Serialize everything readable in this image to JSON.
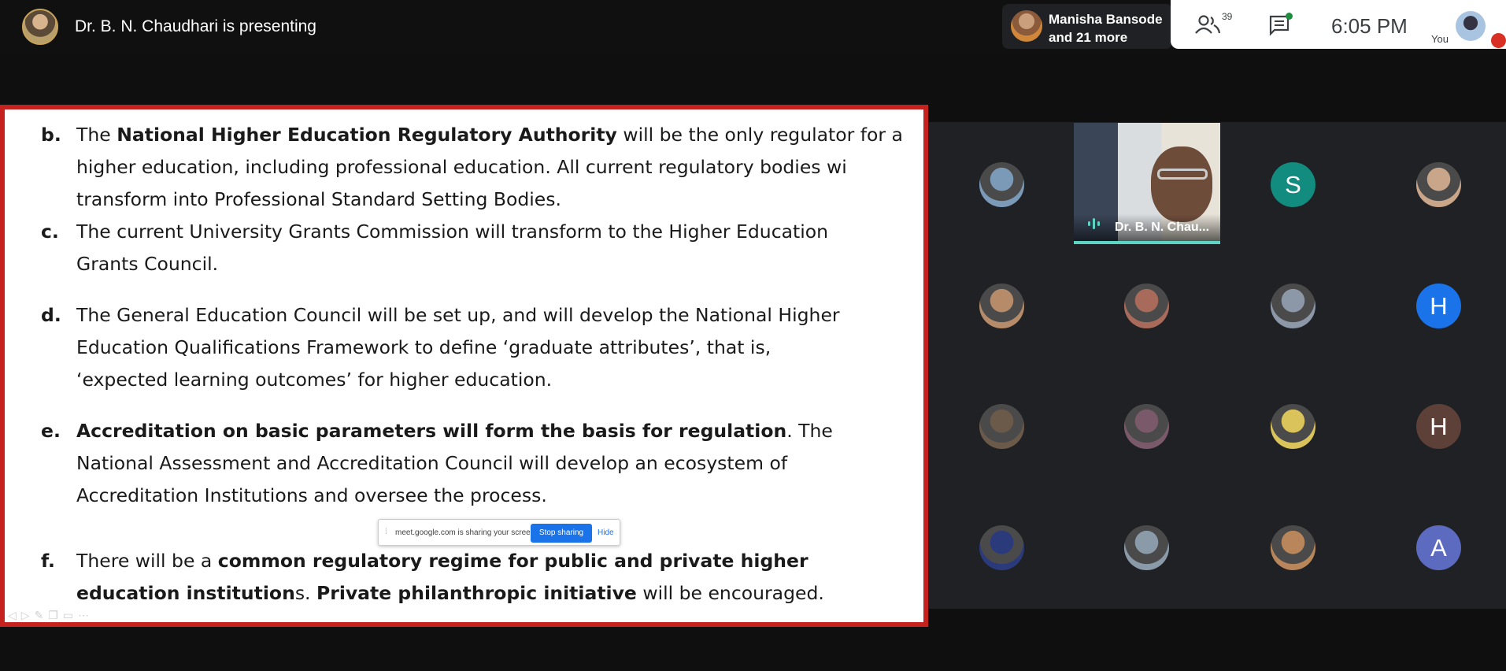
{
  "header": {
    "presenter_label": "Dr. B. N. Chaudhari is presenting",
    "participants_chip": {
      "line1": "Manisha Bansode",
      "line2": "and 21 more"
    },
    "people_count": "39",
    "time": "6:05 PM",
    "you_label": "You"
  },
  "slide": {
    "items": [
      {
        "letter": "b.",
        "lines": [
          [
            [
              "The ",
              false
            ],
            [
              "National Higher Education Regulatory Authority",
              true
            ],
            [
              " will be the only regulator for a",
              false
            ]
          ],
          [
            [
              "higher education, including professional education. All current regulatory bodies wi",
              false
            ]
          ],
          [
            [
              "transform into Professional Standard Setting Bodies.",
              false
            ]
          ]
        ]
      },
      {
        "letter": "c.",
        "lines": [
          [
            [
              "The current University Grants Commission will transform to the Higher Education",
              false
            ]
          ],
          [
            [
              "Grants Council.",
              false
            ]
          ]
        ]
      },
      {
        "letter": "d.",
        "lines": [
          [
            [
              "The General Education Council will be set up, and will develop the National Higher",
              false
            ]
          ],
          [
            [
              "Education Qualifications Framework to define ‘graduate attributes’, that is,",
              false
            ]
          ],
          [
            [
              "‘expected learning outcomes’ for higher education.",
              false
            ]
          ]
        ]
      },
      {
        "letter": "e.",
        "lines": [
          [
            [
              "Accreditation on basic parameters will form the basis for regulation",
              true
            ],
            [
              ". The",
              false
            ]
          ],
          [
            [
              "National Assessment and Accreditation Council will develop an ecosystem of",
              false
            ]
          ],
          [
            [
              "Accreditation Institutions and oversee the process.",
              false
            ]
          ]
        ]
      },
      {
        "letter": "f.",
        "lines": [
          [
            [
              "There will be a ",
              false
            ],
            [
              "common regulatory regime for public and private higher",
              true
            ]
          ],
          [
            [
              "education institution",
              true
            ],
            [
              "s. ",
              false
            ],
            [
              "Private philanthropic initiative",
              true
            ],
            [
              " will be encouraged.",
              false
            ]
          ]
        ]
      }
    ]
  },
  "share_bar": {
    "message": "meet.google.com is sharing your screen.",
    "stop_label": "Stop sharing",
    "hide_label": "Hide"
  },
  "participants": [
    {
      "kind": "photo",
      "color": "#7a9ab8"
    },
    {
      "kind": "video",
      "name": "Dr. B. N. Chau..."
    },
    {
      "kind": "letter",
      "letter": "S",
      "color": "#128c7e"
    },
    {
      "kind": "photo",
      "color": "#c9a58a"
    },
    {
      "kind": "photo",
      "color": "#b58b6a"
    },
    {
      "kind": "photo",
      "color": "#a86a5a"
    },
    {
      "kind": "photo",
      "color": "#8c97a8"
    },
    {
      "kind": "letter",
      "letter": "H",
      "color": "#1a73e8"
    },
    {
      "kind": "photo",
      "color": "#6b5a4a"
    },
    {
      "kind": "photo",
      "color": "#7a5a6a"
    },
    {
      "kind": "photo",
      "color": "#d9c35a"
    },
    {
      "kind": "letter",
      "letter": "H",
      "color": "#5d4037"
    },
    {
      "kind": "photo",
      "color": "#2a3a7a"
    },
    {
      "kind": "photo",
      "color": "#8a9aa8"
    },
    {
      "kind": "photo",
      "color": "#b8865a"
    },
    {
      "kind": "letter",
      "letter": "A",
      "color": "#5c6bc0"
    }
  ]
}
